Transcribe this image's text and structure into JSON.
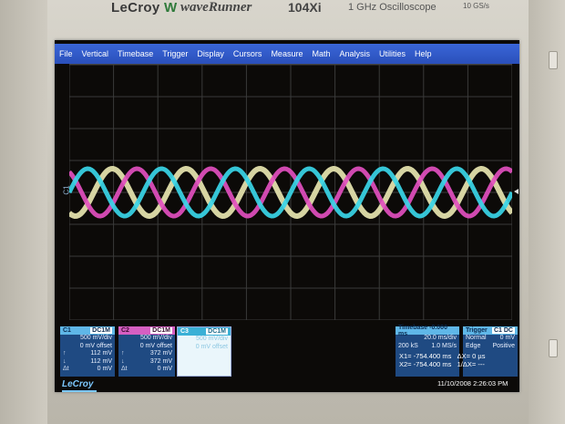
{
  "device": {
    "brand": "LeCroy",
    "brand_w": "W",
    "series": "waveRunner",
    "model": "104Xi",
    "subtitle": "1 GHz Oscilloscope",
    "sample_rate_badge": "10 GS/s"
  },
  "menu": [
    "File",
    "Vertical",
    "Timebase",
    "Trigger",
    "Display",
    "Cursors",
    "Measure",
    "Math",
    "Analysis",
    "Utilities",
    "Help"
  ],
  "channel_marker": "C1",
  "channels": [
    {
      "tag": "C1",
      "coupling": "DC1M",
      "scale": "500 mV/div",
      "offset": "0 mV offset",
      "r1_key": "↑",
      "r1_val": "112 mV",
      "r2_key": "↓",
      "r2_val": "112 mV",
      "r3_key": "Δt",
      "r3_val": "0 mV",
      "color": "#39d6e8"
    },
    {
      "tag": "C2",
      "coupling": "DC1M",
      "scale": "500 mV/div",
      "offset": "0 mV offset",
      "r1_key": "↑",
      "r1_val": "372 mV",
      "r2_key": "↓",
      "r2_val": "372 mV",
      "r3_key": "Δt",
      "r3_val": "0 mV",
      "color": "#e24fbf"
    },
    {
      "tag": "C3",
      "coupling": "DC1M",
      "scale": "500 mV/div",
      "offset": "0 mV offset",
      "r1_key": "",
      "r1_val": "",
      "r2_key": "",
      "r2_val": "",
      "r3_key": "",
      "r3_val": "",
      "color": "#e8e6b0"
    }
  ],
  "timebase": {
    "hdr": "Timebase -0.000 ms",
    "div": "20.0 ms/div",
    "samples": "200 kS",
    "rate": "1.0 MS/s"
  },
  "trigger": {
    "hdr": "Trigger",
    "tag": "C1 DC",
    "mode": "Normal",
    "level": "0 mV",
    "type": "Edge",
    "slope": "Positive"
  },
  "cursors": {
    "x1_label": "X1=",
    "x1": "-754.400 ms",
    "dx_label": "ΔX=",
    "dx": "0 µs",
    "x2_label": "X2=",
    "x2": "-754.400 ms",
    "dy_label": "1/ΔX=",
    "dy": "---"
  },
  "footer": {
    "logo": "LeCroy",
    "timestamp": "11/10/2008 2:26:03 PM"
  }
}
